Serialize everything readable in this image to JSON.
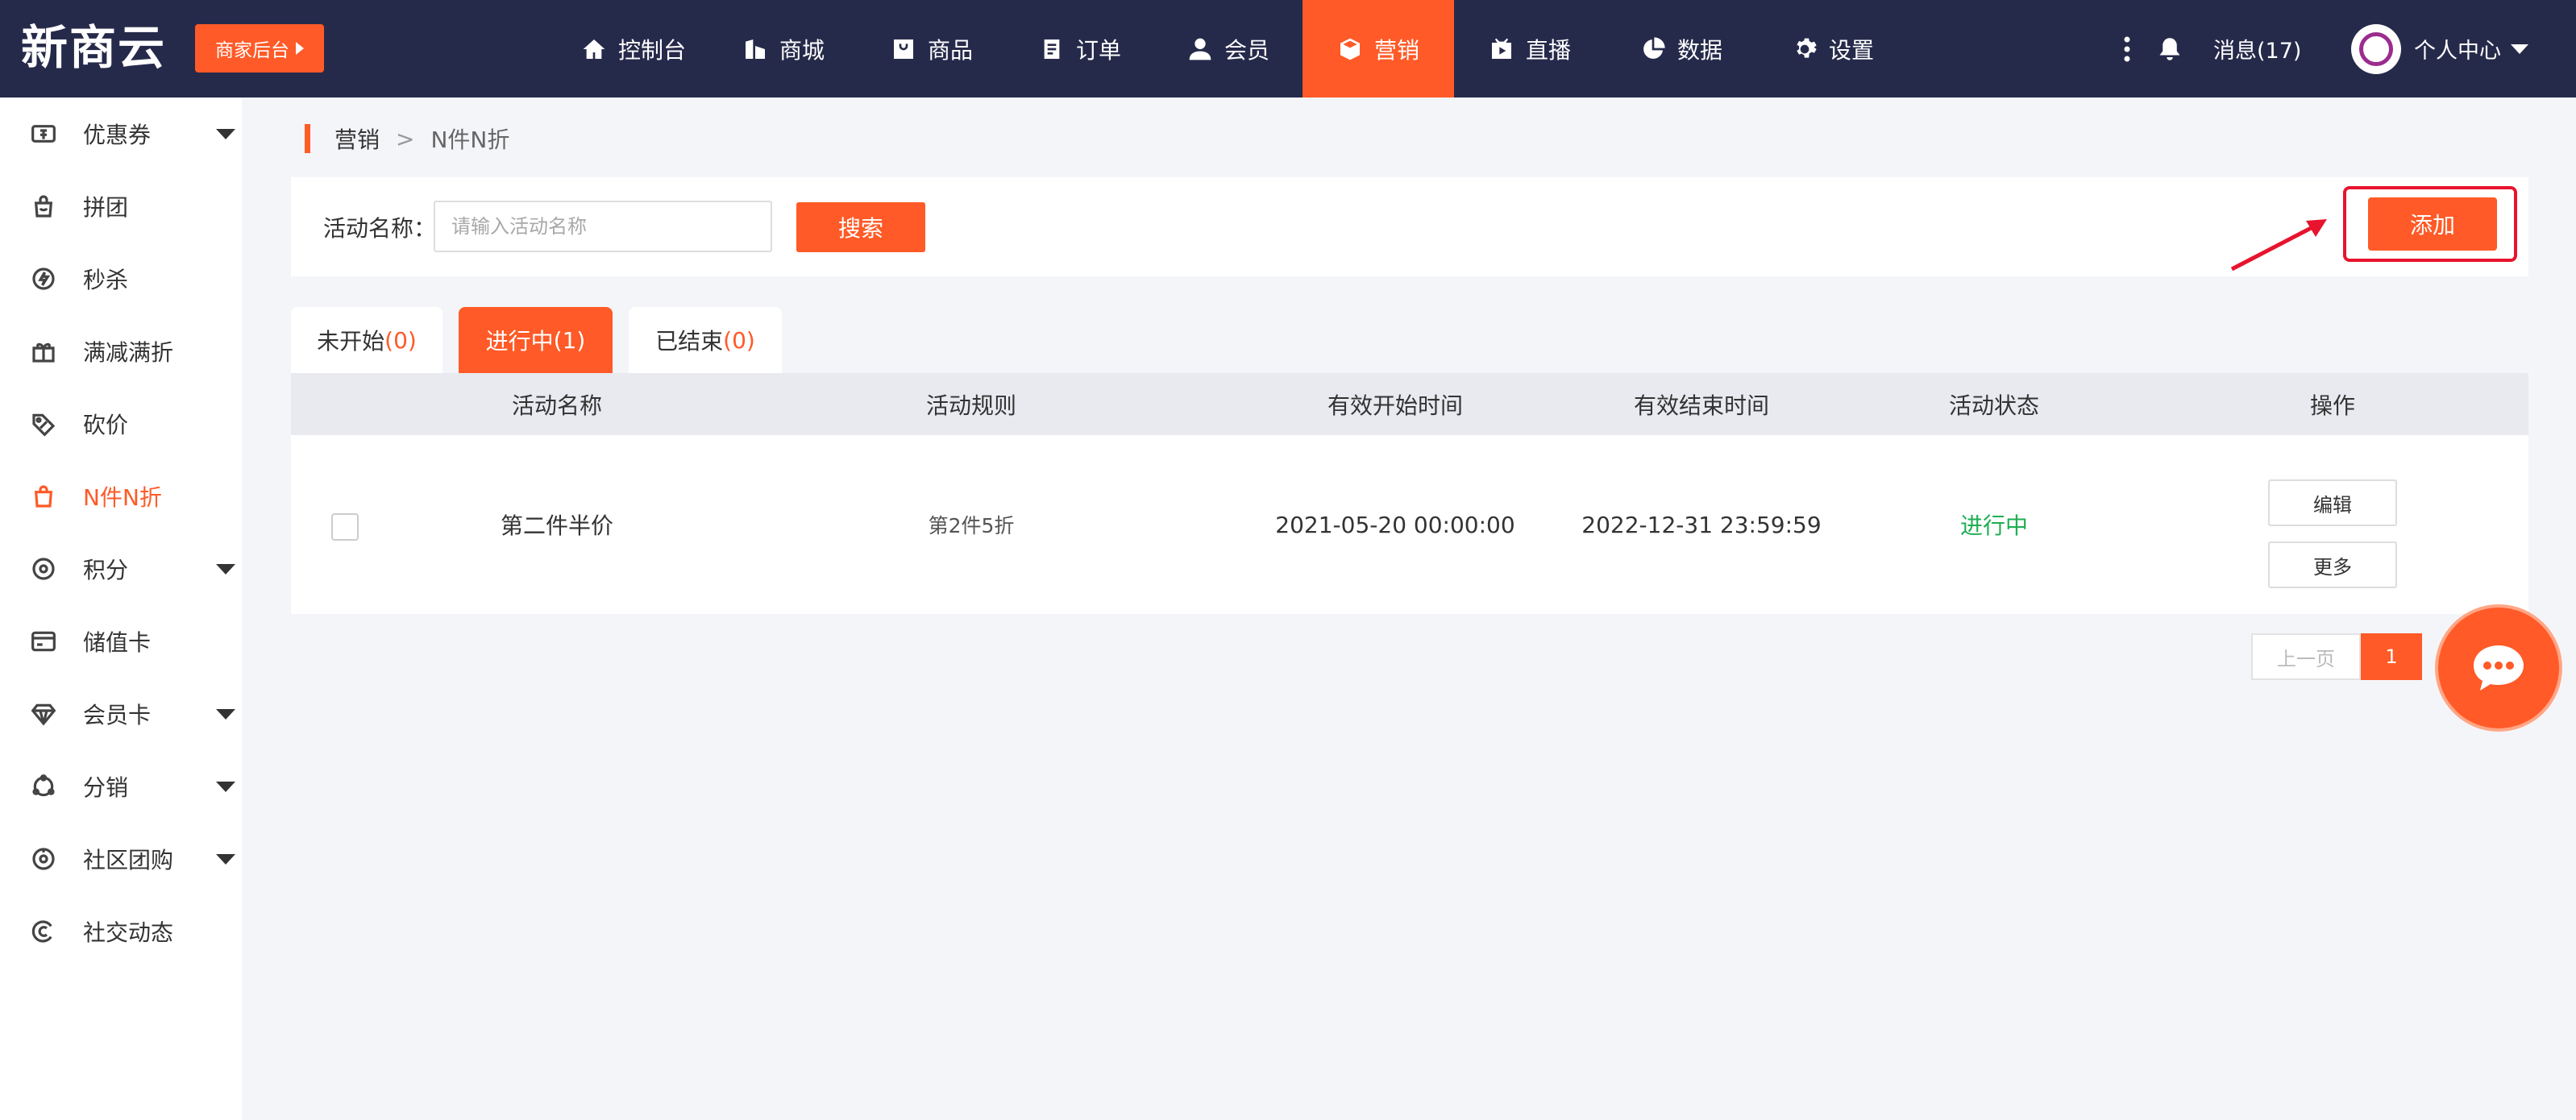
{
  "brand": {
    "logo": "新商云",
    "merchant_label": "商家后台"
  },
  "nav": [
    {
      "label": "控制台",
      "icon": "home-icon"
    },
    {
      "label": "商城",
      "icon": "building-icon"
    },
    {
      "label": "商品",
      "icon": "bag-icon"
    },
    {
      "label": "订单",
      "icon": "clipboard-icon"
    },
    {
      "label": "会员",
      "icon": "user-icon"
    },
    {
      "label": "营销",
      "icon": "cube-icon",
      "active": true
    },
    {
      "label": "直播",
      "icon": "live-icon"
    },
    {
      "label": "数据",
      "icon": "pie-chart-icon"
    },
    {
      "label": "设置",
      "icon": "gear-icon"
    }
  ],
  "header_right": {
    "messages": "消息(17)",
    "profile": "个人中心"
  },
  "sidebar": [
    {
      "label": "优惠券",
      "icon": "ticket-icon",
      "expandable": true
    },
    {
      "label": "拼团",
      "icon": "group-bag-icon"
    },
    {
      "label": "秒杀",
      "icon": "flash-icon"
    },
    {
      "label": "满减满折",
      "icon": "gift-icon"
    },
    {
      "label": "砍价",
      "icon": "tag-icon"
    },
    {
      "label": "N件N折",
      "icon": "shopping-bag-icon",
      "active": true
    },
    {
      "label": "积分",
      "icon": "points-icon",
      "expandable": true
    },
    {
      "label": "储值卡",
      "icon": "card-icon"
    },
    {
      "label": "会员卡",
      "icon": "diamond-icon",
      "expandable": true
    },
    {
      "label": "分销",
      "icon": "share-icon",
      "expandable": true
    },
    {
      "label": "社区团购",
      "icon": "community-icon",
      "expandable": true
    },
    {
      "label": "社交动态",
      "icon": "social-icon"
    }
  ],
  "breadcrumb": {
    "root": "营销",
    "sep": ">",
    "current": "N件N折"
  },
  "search": {
    "label": "活动名称：",
    "placeholder": "请输入活动名称",
    "value": "",
    "button": "搜索"
  },
  "add_button": "添加",
  "tabs": [
    {
      "label": "未开始",
      "count": "(0)"
    },
    {
      "label": "进行中",
      "count": "(1)",
      "active": true
    },
    {
      "label": "已结束",
      "count": "(0)"
    }
  ],
  "table": {
    "headers": [
      "活动名称",
      "活动规则",
      "有效开始时间",
      "有效结束时间",
      "活动状态",
      "操作"
    ],
    "rows": [
      {
        "name": "第二件半价",
        "rule": "第2件5折",
        "start": "2021-05-20 00:00:00",
        "end": "2022-12-31 23:59:59",
        "status": "进行中",
        "actions": [
          "编辑",
          "更多"
        ]
      }
    ]
  },
  "pagination": {
    "prev": "上一页",
    "current": "1"
  },
  "colors": {
    "accent": "#ff5a27",
    "topbar": "#262a4a",
    "status_green": "#1fae54",
    "highlight_red": "#e8132d"
  }
}
